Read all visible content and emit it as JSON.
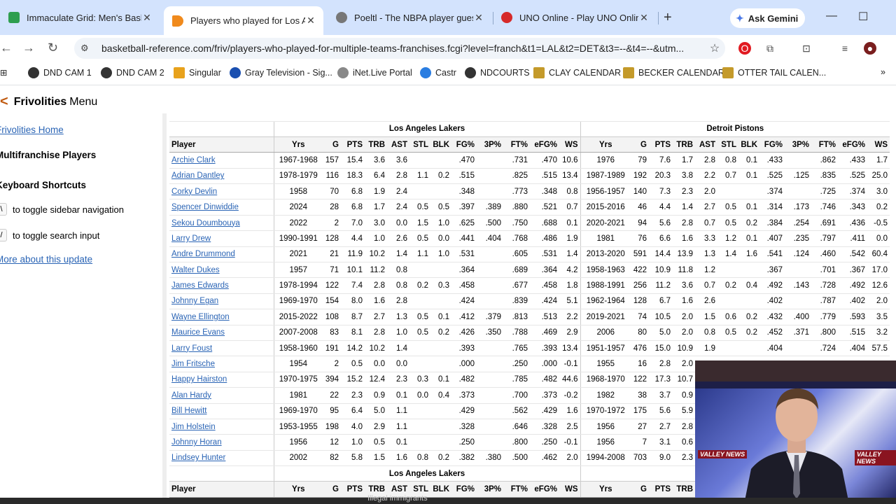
{
  "browser": {
    "tabs": [
      {
        "label": "Immaculate Grid: Men's Basketball",
        "icon_color": "#2e9e4f",
        "active": false
      },
      {
        "label": "Players who played for Los Angeles Lakers",
        "icon_color": "#f08a1c",
        "active": true
      },
      {
        "label": "Poeltl - The NBPA player guessing game",
        "icon_color": "#777777",
        "active": false
      },
      {
        "label": "UNO Online - Play UNO Online",
        "icon_color": "#d62a2a",
        "active": false
      }
    ],
    "new_tab": "+",
    "gemini_label": "Ask Gemini",
    "url": "basketball-reference.com/friv/players-who-played-for-multiple-teams-franchises.fcgi?level=franch&t1=LAL&t2=DET&t3=--&t4=--&utm...",
    "bookmarks": [
      {
        "label": "DND CAM 1",
        "color": "#333333"
      },
      {
        "label": "DND CAM 2",
        "color": "#333333"
      },
      {
        "label": "Singular",
        "color": "#e8a21c"
      },
      {
        "label": "Gray Television - Sig...",
        "color": "#1a4fb0"
      },
      {
        "label": "iNet.Live Portal",
        "color": "#888888"
      },
      {
        "label": "Castr",
        "color": "#2a7de1"
      },
      {
        "label": "NDCOURTS",
        "color": "#333333"
      },
      {
        "label": "CLAY CALENDAR",
        "color": "#c49a2a"
      },
      {
        "label": "BECKER CALENDAR",
        "color": "#c49a2a"
      },
      {
        "label": "OTTER TAIL CALEN...",
        "color": "#c49a2a"
      }
    ]
  },
  "page": {
    "brand": "Frivolities",
    "menu": "Menu",
    "sidebar": {
      "home_link": "Frivolities Home",
      "section": "Multifranchise Players",
      "shortcuts_title": "Keyboard Shortcuts",
      "shortcut1_key": "\\",
      "shortcut1_text": "to toggle sidebar navigation",
      "shortcut2_key": "/",
      "shortcut2_text": "to toggle search input",
      "more_link": "More about this update"
    },
    "table": {
      "team1": "Los Angeles Lakers",
      "team2": "Detroit Pistons",
      "columns_player": "Player",
      "columns_team": [
        "Yrs",
        "G",
        "PTS",
        "TRB",
        "AST",
        "STL",
        "BLK",
        "FG%",
        "3P%",
        "FT%",
        "eFG%",
        "WS"
      ],
      "rows": [
        {
          "player": "Archie Clark",
          "t1": [
            "1967-1968",
            "157",
            "15.4",
            "3.6",
            "3.6",
            "",
            "",
            ".470",
            "",
            ".731",
            ".470",
            "10.6"
          ],
          "t2": [
            "1976",
            "79",
            "7.6",
            "1.7",
            "2.8",
            "0.8",
            "0.1",
            ".433",
            "",
            ".862",
            ".433",
            "1.7"
          ]
        },
        {
          "player": "Adrian Dantley",
          "t1": [
            "1978-1979",
            "116",
            "18.3",
            "6.4",
            "2.8",
            "1.1",
            "0.2",
            ".515",
            "",
            ".825",
            ".515",
            "13.4"
          ],
          "t2": [
            "1987-1989",
            "192",
            "20.3",
            "3.8",
            "2.2",
            "0.7",
            "0.1",
            ".525",
            ".125",
            ".835",
            ".525",
            "25.0"
          ]
        },
        {
          "player": "Corky Devlin",
          "t1": [
            "1958",
            "70",
            "6.8",
            "1.9",
            "2.4",
            "",
            "",
            ".348",
            "",
            ".773",
            ".348",
            "0.8"
          ],
          "t2": [
            "1956-1957",
            "140",
            "7.3",
            "2.3",
            "2.0",
            "",
            "",
            ".374",
            "",
            ".725",
            ".374",
            "3.0"
          ]
        },
        {
          "player": "Spencer Dinwiddie",
          "t1": [
            "2024",
            "28",
            "6.8",
            "1.7",
            "2.4",
            "0.5",
            "0.5",
            ".397",
            ".389",
            ".880",
            ".521",
            "0.7"
          ],
          "t2": [
            "2015-2016",
            "46",
            "4.4",
            "1.4",
            "2.7",
            "0.5",
            "0.1",
            ".314",
            ".173",
            ".746",
            ".343",
            "0.2"
          ]
        },
        {
          "player": "Sekou Doumbouya",
          "t1": [
            "2022",
            "2",
            "7.0",
            "3.0",
            "0.0",
            "1.5",
            "1.0",
            ".625",
            ".500",
            ".750",
            ".688",
            "0.1"
          ],
          "t2": [
            "2020-2021",
            "94",
            "5.6",
            "2.8",
            "0.7",
            "0.5",
            "0.2",
            ".384",
            ".254",
            ".691",
            ".436",
            "-0.5"
          ]
        },
        {
          "player": "Larry Drew",
          "t1": [
            "1990-1991",
            "128",
            "4.4",
            "1.0",
            "2.6",
            "0.5",
            "0.0",
            ".441",
            ".404",
            ".768",
            ".486",
            "1.9"
          ],
          "t2": [
            "1981",
            "76",
            "6.6",
            "1.6",
            "3.3",
            "1.2",
            "0.1",
            ".407",
            ".235",
            ".797",
            ".411",
            "0.0"
          ]
        },
        {
          "player": "Andre Drummond",
          "t1": [
            "2021",
            "21",
            "11.9",
            "10.2",
            "1.4",
            "1.1",
            "1.0",
            ".531",
            "",
            ".605",
            ".531",
            "1.4"
          ],
          "t2": [
            "2013-2020",
            "591",
            "14.4",
            "13.9",
            "1.3",
            "1.4",
            "1.6",
            ".541",
            ".124",
            ".460",
            ".542",
            "60.4"
          ]
        },
        {
          "player": "Walter Dukes",
          "t1": [
            "1957",
            "71",
            "10.1",
            "11.2",
            "0.8",
            "",
            "",
            ".364",
            "",
            ".689",
            ".364",
            "4.2"
          ],
          "t2": [
            "1958-1963",
            "422",
            "10.9",
            "11.8",
            "1.2",
            "",
            "",
            ".367",
            "",
            ".701",
            ".367",
            "17.0"
          ]
        },
        {
          "player": "James Edwards",
          "t1": [
            "1978-1994",
            "122",
            "7.4",
            "2.8",
            "0.8",
            "0.2",
            "0.3",
            ".458",
            "",
            ".677",
            ".458",
            "1.8"
          ],
          "t2": [
            "1988-1991",
            "256",
            "11.2",
            "3.6",
            "0.7",
            "0.2",
            "0.4",
            ".492",
            ".143",
            ".728",
            ".492",
            "12.6"
          ]
        },
        {
          "player": "Johnny Egan",
          "t1": [
            "1969-1970",
            "154",
            "8.0",
            "1.6",
            "2.8",
            "",
            "",
            ".424",
            "",
            ".839",
            ".424",
            "5.1"
          ],
          "t2": [
            "1962-1964",
            "128",
            "6.7",
            "1.6",
            "2.6",
            "",
            "",
            ".402",
            "",
            ".787",
            ".402",
            "2.0"
          ]
        },
        {
          "player": "Wayne Ellington",
          "t1": [
            "2015-2022",
            "108",
            "8.7",
            "2.7",
            "1.3",
            "0.5",
            "0.1",
            ".412",
            ".379",
            ".813",
            ".513",
            "2.2"
          ],
          "t2": [
            "2019-2021",
            "74",
            "10.5",
            "2.0",
            "1.5",
            "0.6",
            "0.2",
            ".432",
            ".400",
            ".779",
            ".593",
            "3.5"
          ]
        },
        {
          "player": "Maurice Evans",
          "t1": [
            "2007-2008",
            "83",
            "8.1",
            "2.8",
            "1.0",
            "0.5",
            "0.2",
            ".426",
            ".350",
            ".788",
            ".469",
            "2.9"
          ],
          "t2": [
            "2006",
            "80",
            "5.0",
            "2.0",
            "0.8",
            "0.5",
            "0.2",
            ".452",
            ".371",
            ".800",
            ".515",
            "3.2"
          ]
        },
        {
          "player": "Larry Foust",
          "t1": [
            "1958-1960",
            "191",
            "14.2",
            "10.2",
            "1.4",
            "",
            "",
            ".393",
            "",
            ".765",
            ".393",
            "13.4"
          ],
          "t2": [
            "1951-1957",
            "476",
            "15.0",
            "10.9",
            "1.9",
            "",
            "",
            ".404",
            "",
            ".724",
            ".404",
            "57.5"
          ]
        },
        {
          "player": "Jim Fritsche",
          "t1": [
            "1954",
            "2",
            "0.5",
            "0.0",
            "0.0",
            "",
            "",
            ".000",
            "",
            ".250",
            ".000",
            "-0.1"
          ],
          "t2": [
            "1955",
            "16",
            "2.8",
            "2.0",
            "",
            "",
            "",
            "",
            "",
            "",
            "",
            ""
          ]
        },
        {
          "player": "Happy Hairston",
          "t1": [
            "1970-1975",
            "394",
            "15.2",
            "12.4",
            "2.3",
            "0.3",
            "0.1",
            ".482",
            "",
            ".785",
            ".482",
            "44.6"
          ],
          "t2": [
            "1968-1970",
            "122",
            "17.3",
            "10.7",
            "",
            "",
            "",
            "",
            "",
            "",
            "",
            ""
          ]
        },
        {
          "player": "Alan Hardy",
          "t1": [
            "1981",
            "22",
            "2.3",
            "0.9",
            "0.1",
            "0.0",
            "0.4",
            ".373",
            "",
            ".700",
            ".373",
            "-0.2"
          ],
          "t2": [
            "1982",
            "38",
            "3.7",
            "0.9",
            "",
            "",
            "",
            "",
            "",
            "",
            "",
            ""
          ]
        },
        {
          "player": "Bill Hewitt",
          "t1": [
            "1969-1970",
            "95",
            "6.4",
            "5.0",
            "1.1",
            "",
            "",
            ".429",
            "",
            ".562",
            ".429",
            "1.6"
          ],
          "t2": [
            "1970-1972",
            "175",
            "5.6",
            "5.9",
            "",
            "",
            "",
            "",
            "",
            "",
            "",
            ""
          ]
        },
        {
          "player": "Jim Holstein",
          "t1": [
            "1953-1955",
            "198",
            "4.0",
            "2.9",
            "1.1",
            "",
            "",
            ".328",
            "",
            ".646",
            ".328",
            "2.5"
          ],
          "t2": [
            "1956",
            "27",
            "2.7",
            "2.8",
            "",
            "",
            "",
            "",
            "",
            "",
            "",
            ""
          ]
        },
        {
          "player": "Johnny Horan",
          "t1": [
            "1956",
            "12",
            "1.0",
            "0.5",
            "0.1",
            "",
            "",
            ".250",
            "",
            ".800",
            ".250",
            "-0.1"
          ],
          "t2": [
            "1956",
            "7",
            "3.1",
            "0.6",
            "",
            "",
            "",
            "",
            "",
            "",
            "",
            ""
          ]
        },
        {
          "player": "Lindsey Hunter",
          "t1": [
            "2002",
            "82",
            "5.8",
            "1.5",
            "1.6",
            "0.8",
            "0.2",
            ".382",
            ".380",
            ".500",
            ".462",
            "2.0"
          ],
          "t2": [
            "1994-2008",
            "703",
            "9.0",
            "2.3",
            "",
            "",
            "",
            "",
            "",
            "",
            "",
            ""
          ]
        }
      ]
    }
  },
  "webcam": {
    "logo_left": "VALLEY NEWS",
    "logo_right": "VALLEY NEWS"
  },
  "caption": "Illegal immigrants"
}
